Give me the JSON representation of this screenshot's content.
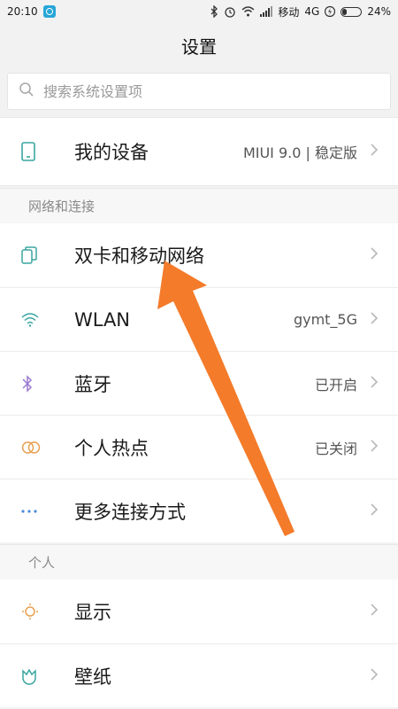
{
  "status_bar": {
    "time": "20:10",
    "carrier": "移动",
    "network": "4G",
    "battery": "24%",
    "battery_level": 0.24
  },
  "title": "设置",
  "search": {
    "placeholder": "搜索系统设置项"
  },
  "device": {
    "label": "我的设备",
    "value": "MIUI 9.0 | 稳定版",
    "icon": "phone-icon"
  },
  "network_section": {
    "header": "网络和连接",
    "items": [
      {
        "label": "双卡和移动网络",
        "value": "",
        "icon": "sim-card-icon"
      },
      {
        "label": "WLAN",
        "value": "gymt_5G",
        "icon": "wifi-icon"
      },
      {
        "label": "蓝牙",
        "value": "已开启",
        "icon": "bluetooth-icon"
      },
      {
        "label": "个人热点",
        "value": "已关闭",
        "icon": "hotspot-icon"
      },
      {
        "label": "更多连接方式",
        "value": "",
        "icon": "more-icon"
      }
    ]
  },
  "personal_section": {
    "header": "个人",
    "items": [
      {
        "label": "显示",
        "value": "",
        "icon": "display-icon"
      },
      {
        "label": "壁纸",
        "value": "",
        "icon": "wallpaper-icon"
      }
    ]
  },
  "colors": {
    "annotation_arrow": "#f47b2a",
    "icon_teal": "#3aa6a0",
    "icon_purple": "#9a7ad0",
    "icon_orange": "#e8a050"
  }
}
